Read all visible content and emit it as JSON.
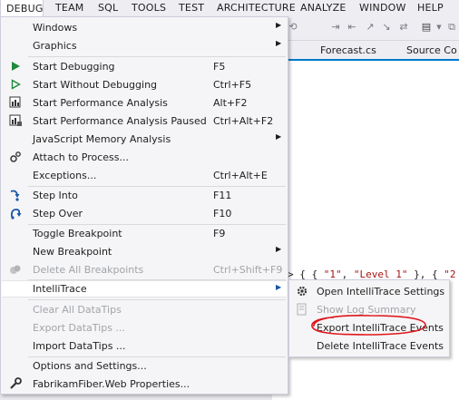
{
  "menubar": {
    "items": [
      "DEBUG",
      "TEAM",
      "SQL",
      "TOOLS",
      "TEST",
      "ARCHITECTURE",
      "ANALYZE",
      "WINDOW",
      "HELP"
    ]
  },
  "tabs": [
    "Forecast.cs",
    "Source Co"
  ],
  "code_line": {
    "prefix": "> { { ",
    "s1": "\"1\"",
    "mid": ", ",
    "s2": "\"Level 1\"",
    "suffix": " }, { ",
    "s3": "\"2"
  },
  "menu": {
    "windows": "Windows",
    "graphics": "Graphics",
    "start_debugging": {
      "label": "Start Debugging",
      "shortcut": "F5"
    },
    "start_without_debugging": {
      "label": "Start Without Debugging",
      "shortcut": "Ctrl+F5"
    },
    "start_perf": {
      "label": "Start Performance Analysis",
      "shortcut": "Alt+F2"
    },
    "start_perf_paused": {
      "label": "Start Performance Analysis Paused",
      "shortcut": "Ctrl+Alt+F2"
    },
    "js_memory": "JavaScript Memory Analysis",
    "attach": "Attach to Process...",
    "exceptions": {
      "label": "Exceptions...",
      "shortcut": "Ctrl+Alt+E"
    },
    "step_into": {
      "label": "Step Into",
      "shortcut": "F11"
    },
    "step_over": {
      "label": "Step Over",
      "shortcut": "F10"
    },
    "toggle_bp": {
      "label": "Toggle Breakpoint",
      "shortcut": "F9"
    },
    "new_bp": "New Breakpoint",
    "delete_all_bp": {
      "label": "Delete All Breakpoints",
      "shortcut": "Ctrl+Shift+F9"
    },
    "intellitrace": "IntelliTrace",
    "clear_datatips": "Clear All DataTips",
    "export_datatips": "Export DataTips ...",
    "import_datatips": "Import DataTips ...",
    "options": "Options and Settings...",
    "properties": "FabrikamFiber.Web Properties..."
  },
  "submenu": {
    "open_settings": "Open IntelliTrace Settings",
    "show_log": "Show Log Summary",
    "export_events": "Export IntelliTrace Events",
    "delete_events": "Delete IntelliTrace Events"
  },
  "colors": {
    "play_green": "#1f8a3c",
    "accent_blue": "#007acc",
    "annotation_red": "#e0161b"
  }
}
